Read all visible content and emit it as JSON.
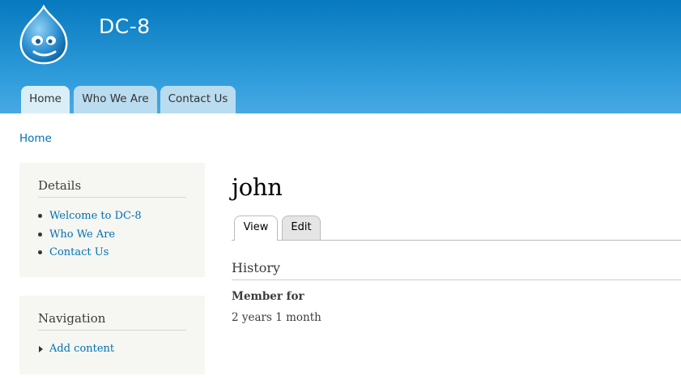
{
  "site": {
    "name": "DC-8",
    "logo_icon": "drupal-drop-icon"
  },
  "main_menu": [
    {
      "label": "Home",
      "active": true
    },
    {
      "label": "Who We Are",
      "active": false
    },
    {
      "label": "Contact Us",
      "active": false
    }
  ],
  "breadcrumb": {
    "home": "Home"
  },
  "sidebar": {
    "details": {
      "title": "Details",
      "links": [
        "Welcome to DC-8",
        "Who We Are",
        "Contact Us"
      ]
    },
    "navigation": {
      "title": "Navigation",
      "links": [
        "Add content"
      ]
    }
  },
  "content": {
    "title": "john",
    "tabs": {
      "view": "View",
      "edit": "Edit"
    },
    "history": {
      "title": "History",
      "member_label": "Member for",
      "member_value": "2 years 1 month"
    }
  },
  "colors": {
    "header_top": "#0779bf",
    "header_bottom": "#48a9e4",
    "link": "#0071b3",
    "sidebar_bg": "#f6f6f2",
    "menu_tab": "#b9dcf0"
  }
}
